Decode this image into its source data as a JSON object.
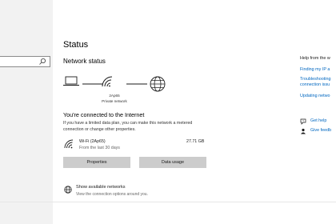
{
  "main": {
    "page_title": "Status",
    "section_title": "Network status",
    "network": {
      "name": "2Ap65",
      "type": "Private network"
    },
    "connected_heading": "You're connected to the Internet",
    "limited_plan_text": "If you have a limited data plan, you can make this network a metered connection or change other properties.",
    "wifi": {
      "name": "Wi-Fi (2Ap65)",
      "since": "From the last 30 days",
      "usage": "27.71 GB"
    },
    "buttons": {
      "properties": "Properties",
      "data_usage": "Data usage"
    },
    "show_networks": {
      "title": "Show available networks",
      "subtitle": "View the connection options around you."
    }
  },
  "right_pane": {
    "help_title": "Help from the w",
    "links": [
      "Finding my IP a",
      "Troubleshooting",
      "connection issu",
      "Updating netwo"
    ],
    "get_help": "Get help",
    "give_feedback": "Give feedb"
  },
  "colors": {
    "accent": "#0067c0",
    "button_bg": "#cccccc",
    "left_pane_bg": "#f2f2f2"
  }
}
